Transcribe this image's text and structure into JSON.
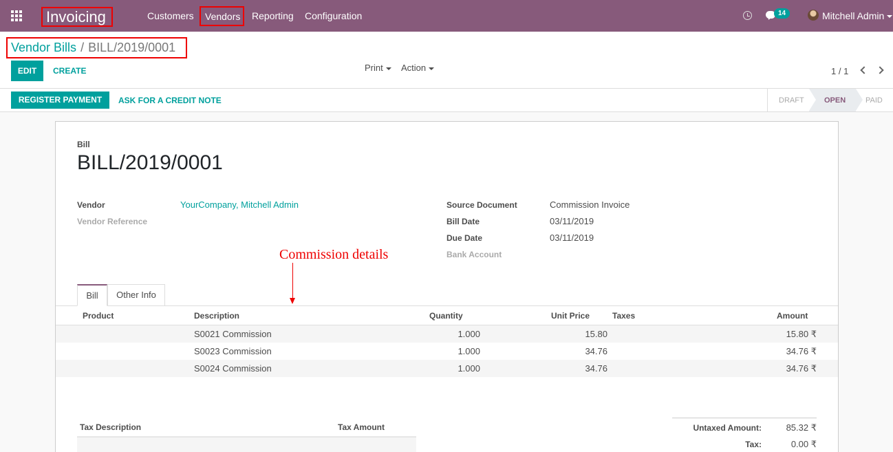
{
  "navbar": {
    "app_title": "Invoicing",
    "menu": [
      "Customers",
      "Vendors",
      "Reporting",
      "Configuration"
    ],
    "message_count": "14",
    "user_name": "Mitchell Admin"
  },
  "breadcrumb": {
    "parent": "Vendor Bills",
    "separator": "/",
    "current": "BILL/2019/0001"
  },
  "toolbar": {
    "edit_label": "EDIT",
    "create_label": "CREATE",
    "print_label": "Print",
    "action_label": "Action",
    "pager": "1 / 1"
  },
  "statusbar": {
    "register_label": "REGISTER PAYMENT",
    "credit_label": "ASK FOR A CREDIT NOTE",
    "states": [
      "DRAFT",
      "OPEN",
      "PAID"
    ],
    "active_state": "OPEN"
  },
  "bill": {
    "type_label": "Bill",
    "number": "BILL/2019/0001",
    "vendor_label": "Vendor",
    "vendor_value": "YourCompany, Mitchell Admin",
    "vendor_ref_label": "Vendor Reference",
    "source_label": "Source Document",
    "source_value": "Commission Invoice",
    "bill_date_label": "Bill Date",
    "bill_date_value": "03/11/2019",
    "due_date_label": "Due Date",
    "due_date_value": "03/11/2019",
    "bank_label": "Bank Account"
  },
  "annotation": "Commission details",
  "tabs": [
    "Bill",
    "Other Info"
  ],
  "lines": {
    "headers": [
      "Product",
      "Description",
      "Quantity",
      "Unit Price",
      "Taxes",
      "Amount"
    ],
    "rows": [
      {
        "description": "S0021 Commission",
        "quantity": "1.000",
        "unit_price": "15.80",
        "amount": "15.80 ₹"
      },
      {
        "description": "S0023 Commission",
        "quantity": "1.000",
        "unit_price": "34.76",
        "amount": "34.76 ₹"
      },
      {
        "description": "S0024 Commission",
        "quantity": "1.000",
        "unit_price": "34.76",
        "amount": "34.76 ₹"
      }
    ]
  },
  "tax_table": {
    "headers": [
      "Tax Description",
      "Tax Amount"
    ]
  },
  "totals": {
    "untaxed_label": "Untaxed Amount:",
    "untaxed_value": "85.32 ₹",
    "tax_label": "Tax:",
    "tax_value": "0.00 ₹"
  },
  "colors": {
    "brand": "#875a7b",
    "accent": "#00a09d",
    "annotation": "#ee0000"
  }
}
